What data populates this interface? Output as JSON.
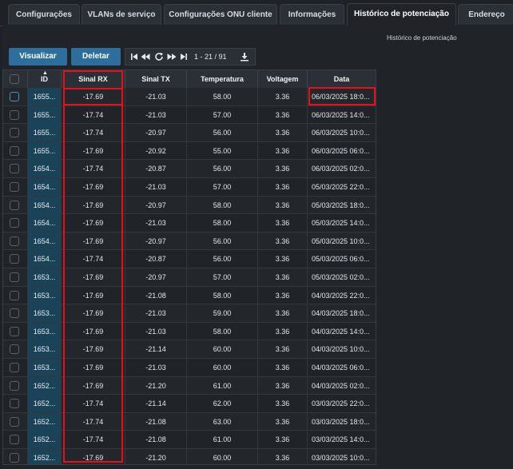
{
  "tabs": [
    {
      "label": "Configurações"
    },
    {
      "label": "VLANs de serviço"
    },
    {
      "label": "Configurações ONU cliente"
    },
    {
      "label": "Informações"
    },
    {
      "label": "Histórico de potenciação"
    },
    {
      "label": "Endereço"
    }
  ],
  "active_tab": "Histórico de potenciação",
  "subtitle": "Histórico de potenciação",
  "toolbar": {
    "view_label": "Visualizar",
    "delete_label": "Deletar"
  },
  "pager": {
    "range": "1 - 21 / 91"
  },
  "columns": [
    "ID",
    "Sinal RX",
    "Sinal TX",
    "Temperatura",
    "Voltagem",
    "Data"
  ],
  "rows": [
    {
      "id": "1655...",
      "rx": "-17.69",
      "tx": "-21.03",
      "temp": "58.00",
      "volt": "3.36",
      "date": "06/03/2025 18:0..."
    },
    {
      "id": "1655...",
      "rx": "-17.74",
      "tx": "-21.03",
      "temp": "57.00",
      "volt": "3.36",
      "date": "06/03/2025 14:0..."
    },
    {
      "id": "1655...",
      "rx": "-17.74",
      "tx": "-20.97",
      "temp": "56.00",
      "volt": "3.36",
      "date": "06/03/2025 10:0..."
    },
    {
      "id": "1655...",
      "rx": "-17.69",
      "tx": "-20.92",
      "temp": "55.00",
      "volt": "3.36",
      "date": "06/03/2025 06:0..."
    },
    {
      "id": "1654...",
      "rx": "-17.74",
      "tx": "-20.87",
      "temp": "56.00",
      "volt": "3.36",
      "date": "06/03/2025 02:0..."
    },
    {
      "id": "1654...",
      "rx": "-17.69",
      "tx": "-21.03",
      "temp": "57.00",
      "volt": "3.36",
      "date": "05/03/2025 22:0..."
    },
    {
      "id": "1654...",
      "rx": "-17.69",
      "tx": "-20.97",
      "temp": "58.00",
      "volt": "3.36",
      "date": "05/03/2025 18:0..."
    },
    {
      "id": "1654...",
      "rx": "-17.69",
      "tx": "-21.03",
      "temp": "58.00",
      "volt": "3.36",
      "date": "05/03/2025 14:0..."
    },
    {
      "id": "1654...",
      "rx": "-17.69",
      "tx": "-20.97",
      "temp": "56.00",
      "volt": "3.36",
      "date": "05/03/2025 10:0..."
    },
    {
      "id": "1654...",
      "rx": "-17.74",
      "tx": "-20.87",
      "temp": "56.00",
      "volt": "3.36",
      "date": "05/03/2025 06:0..."
    },
    {
      "id": "1653...",
      "rx": "-17.69",
      "tx": "-20.97",
      "temp": "57.00",
      "volt": "3.36",
      "date": "05/03/2025 02:0..."
    },
    {
      "id": "1653...",
      "rx": "-17.69",
      "tx": "-21.08",
      "temp": "58.00",
      "volt": "3.36",
      "date": "04/03/2025 22:0..."
    },
    {
      "id": "1653...",
      "rx": "-17.69",
      "tx": "-21.03",
      "temp": "59.00",
      "volt": "3.36",
      "date": "04/03/2025 18:0..."
    },
    {
      "id": "1653...",
      "rx": "-17.69",
      "tx": "-21.03",
      "temp": "58.00",
      "volt": "3.36",
      "date": "04/03/2025 14:0..."
    },
    {
      "id": "1653...",
      "rx": "-17.69",
      "tx": "-21.14",
      "temp": "60.00",
      "volt": "3.36",
      "date": "04/03/2025 10:0..."
    },
    {
      "id": "1653...",
      "rx": "-17.69",
      "tx": "-21.03",
      "temp": "60.00",
      "volt": "3.36",
      "date": "04/03/2025 06:0..."
    },
    {
      "id": "1652...",
      "rx": "-17.69",
      "tx": "-21.20",
      "temp": "61.00",
      "volt": "3.36",
      "date": "04/03/2025 02:0..."
    },
    {
      "id": "1652...",
      "rx": "-17.74",
      "tx": "-21.14",
      "temp": "62.00",
      "volt": "3.36",
      "date": "03/03/2025 22:0..."
    },
    {
      "id": "1652...",
      "rx": "-17.74",
      "tx": "-21.08",
      "temp": "63.00",
      "volt": "3.36",
      "date": "03/03/2025 18:0..."
    },
    {
      "id": "1652...",
      "rx": "-17.74",
      "tx": "-21.08",
      "temp": "61.00",
      "volt": "3.36",
      "date": "03/03/2025 14:0..."
    },
    {
      "id": "1652...",
      "rx": "-17.69",
      "tx": "-21.20",
      "temp": "60.00",
      "volt": "3.36",
      "date": "03/03/2025 10:0..."
    }
  ],
  "colors": {
    "accent": "#2d6e9c",
    "highlight": "#e81018",
    "id_column": "#1b4358"
  }
}
